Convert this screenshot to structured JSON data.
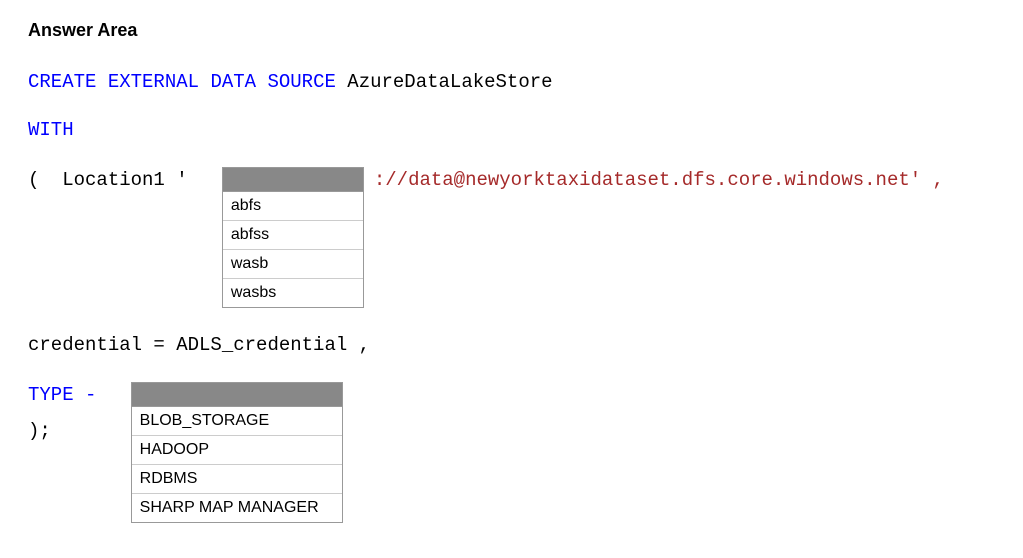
{
  "header": "Answer Area",
  "line1": {
    "create": "CREATE",
    "external": "EXTERNAL",
    "data": "DATA",
    "source": "SOURCE",
    "name": "AzureDataLakeStore"
  },
  "with": "WITH",
  "location": {
    "prefix_paren": "(",
    "prefix_text": "Location1 '",
    "suffix": "://data@newyorktaxidataset.dfs.core.windows.net'  ,",
    "dropdown": [
      "abfs",
      "abfss",
      "wasb",
      "wasbs"
    ]
  },
  "credential": "credential = ADLS_credential ,",
  "type": {
    "label": "TYPE -",
    "dropdown": [
      "BLOB_STORAGE",
      "HADOOP",
      "RDBMS",
      "SHARP MAP MANAGER"
    ]
  },
  "closing": ");"
}
